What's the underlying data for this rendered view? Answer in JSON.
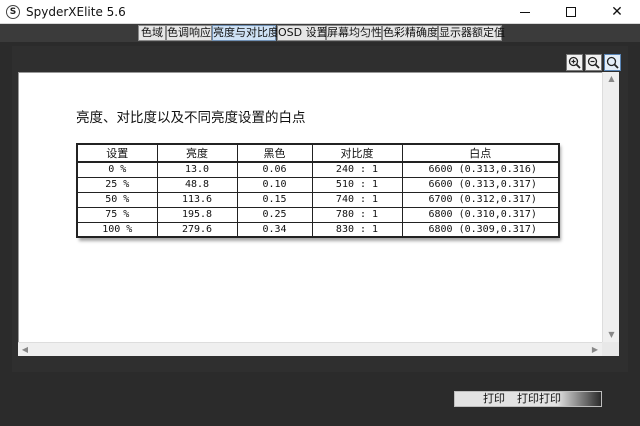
{
  "window": {
    "title": "SpyderXElite 5.6",
    "app_icon_letter": "S"
  },
  "tabs": [
    {
      "label": "色域",
      "active": false
    },
    {
      "label": "色调响应",
      "active": false
    },
    {
      "label": "亮度与对比度",
      "active": true
    },
    {
      "label": "OSD 设置",
      "active": false
    },
    {
      "label": "屏幕均匀性",
      "active": false
    },
    {
      "label": "色彩精确度",
      "active": false
    },
    {
      "label": "显示器额定值",
      "active": false
    }
  ],
  "toolbar": {
    "zoom_in_icon": "zoom-in-icon",
    "zoom_out_icon": "zoom-out-icon",
    "zoom_fit_icon": "zoom-fit-icon"
  },
  "report": {
    "title": "亮度、对比度以及不同亮度设置的白点",
    "columns": [
      "设置",
      "亮度",
      "黑色",
      "对比度",
      "白点"
    ],
    "rows": [
      [
        "0 %",
        "13.0",
        "0.06",
        "240 : 1",
        "6600 (0.313,0.316)"
      ],
      [
        "25 %",
        "48.8",
        "0.10",
        "510 : 1",
        "6600 (0.313,0.317)"
      ],
      [
        "50 %",
        "113.6",
        "0.15",
        "740 : 1",
        "6700 (0.312,0.317)"
      ],
      [
        "75 %",
        "195.8",
        "0.25",
        "780 : 1",
        "6800 (0.310,0.317)"
      ],
      [
        "100 %",
        "279.6",
        "0.34",
        "830 : 1",
        "6800 (0.309,0.317)"
      ]
    ]
  },
  "bottom": {
    "print_label": "打印",
    "print_preview_label": "打印打印"
  },
  "colors": {
    "active_tab": "#cfe2f5",
    "window_bg": "#2b2b2b",
    "content_bg": "#ffffff"
  }
}
